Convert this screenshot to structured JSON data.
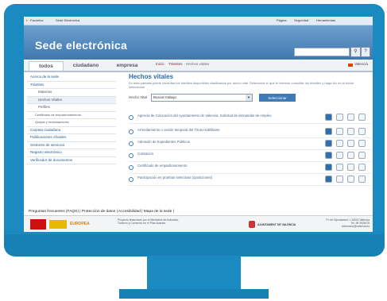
{
  "browser": {
    "favorites_label": "Favoritos",
    "tab_title": "Sede Electrónica",
    "menu_items": [
      "Página",
      "Seguridad",
      "Herramientas"
    ]
  },
  "header": {
    "title": "Sede electrónica"
  },
  "tabs": [
    {
      "label": "todos"
    },
    {
      "label": "ciudadano"
    },
    {
      "label": "empresa"
    }
  ],
  "breadcrumb": [
    "Inicio",
    "Trámites",
    "Hechos vitales"
  ],
  "language": "Valencià",
  "sidebar": {
    "items": [
      {
        "label": "Acerca de la sede"
      },
      {
        "label": "Trámites"
      },
      {
        "label": "Materias"
      },
      {
        "label": "Hechos Vitales"
      },
      {
        "label": "Perfiles"
      },
      {
        "label": "Certificado de empadronamiento"
      },
      {
        "label": "Quejas y reclamaciones"
      },
      {
        "label": "Carpeta ciudadana"
      },
      {
        "label": "Publicaciones oficiales"
      },
      {
        "label": "Gestores de servicios"
      },
      {
        "label": "Registro electrónico"
      },
      {
        "label": "Verificador de documentos"
      }
    ]
  },
  "content": {
    "title": "Hechos vitales",
    "description": "En esta pantalla puede consultar los trámites disponibles clasificados por hecho vital. Seleccione el que le interese consultar los trámites y haga clic en el botón seleccionar",
    "filter_label": "Hecho Vital",
    "filter_value": "Buscar trabajo",
    "button_label": "Seleccionar",
    "procedures": [
      {
        "label": "Agencia de Colocación del Ayuntamiento de Valencia. Solicitud de demandas de empleo"
      },
      {
        "label": "Arrendamiento o cesión temporal del Título Habilitante"
      },
      {
        "label": "Admisión de Expedientes Públicos"
      },
      {
        "label": "Cotización"
      },
      {
        "label": "Certificado de empadronamiento"
      },
      {
        "label": "Participación en pruebas selectivas (oposiciones)"
      }
    ]
  },
  "footer": {
    "links": "Preguntas frecuentes (FAQS) | Protección de datos | Accesibilidad | Mapa de la sede |",
    "eu_text": "EUROPEA",
    "project_text": "Proyecto financiado por el Ministerio de Industria, Turismo y Comercio en el Plan Avanza",
    "ayto": "AJUNTAMENT DE VALÈNCIA",
    "address": "Pl. de l'Ajuntament, 1 46002 València Tel. 96 3525478 informacio@valencia.es"
  }
}
